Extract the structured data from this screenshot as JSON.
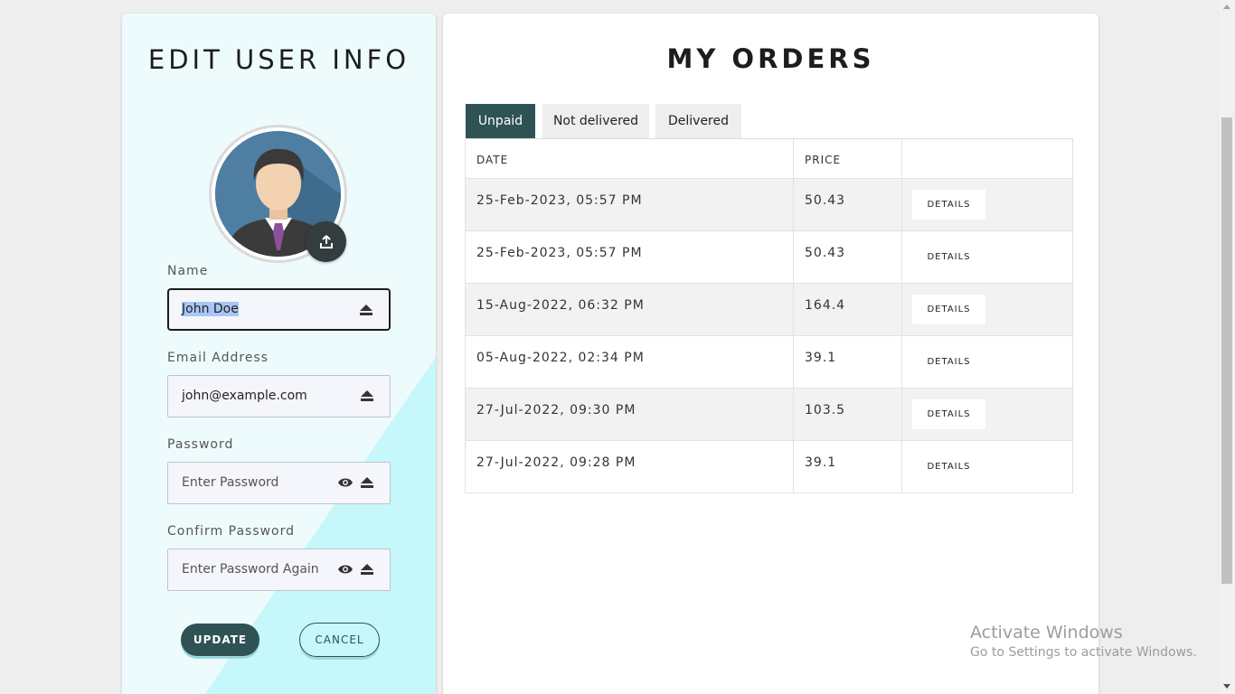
{
  "edit_panel": {
    "title": "EDIT USER INFO",
    "upload_icon": "upload-icon",
    "fields": [
      {
        "label": "Name",
        "value": "John Doe",
        "placeholder": ""
      },
      {
        "label": "Email Address",
        "value": "john@example.com",
        "placeholder": ""
      },
      {
        "label": "Password",
        "value": "",
        "placeholder": "Enter Password"
      },
      {
        "label": "Confirm Password",
        "value": "",
        "placeholder": "Enter Password Again"
      }
    ],
    "update_label": "UPDATE",
    "cancel_label": "CANCEL"
  },
  "orders_panel": {
    "title": "MY ORDERS",
    "tabs": [
      "Unpaid",
      "Not delivered",
      "Delivered"
    ],
    "active_tab": "Unpaid",
    "columns": [
      "DATE",
      "PRICE",
      ""
    ],
    "rows": [
      {
        "date": "25-Feb-2023, 05:57 PM",
        "price": "50.43",
        "action": "DETAILS"
      },
      {
        "date": "25-Feb-2023, 05:57 PM",
        "price": "50.43",
        "action": "DETAILS"
      },
      {
        "date": "15-Aug-2022, 06:32 PM",
        "price": "164.4",
        "action": "DETAILS"
      },
      {
        "date": "05-Aug-2022, 02:34 PM",
        "price": "39.1",
        "action": "DETAILS"
      },
      {
        "date": "27-Jul-2022, 09:30 PM",
        "price": "103.5",
        "action": "DETAILS"
      },
      {
        "date": "27-Jul-2022, 09:28 PM",
        "price": "39.1",
        "action": "DETAILS"
      }
    ]
  },
  "watermark": {
    "line1": "Activate Windows",
    "line2": "Go to Settings to activate Windows."
  },
  "colors": {
    "accent": "#2f5254",
    "left_bg": "#eefbfd",
    "left_diagonal": "#c6f7fb"
  }
}
